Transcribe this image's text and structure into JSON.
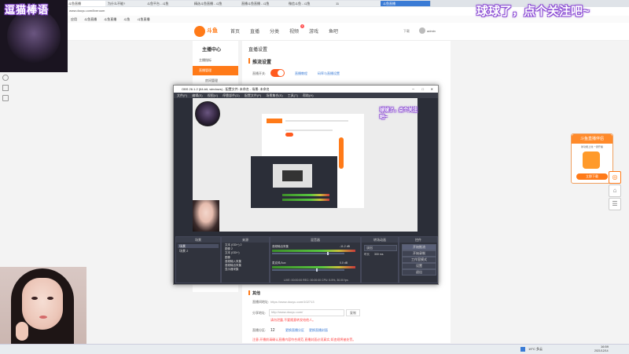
{
  "browser": {
    "tabs": [
      "斗鱼直播",
      "11",
      "为什么不能?",
      "斗鱼平台 - 斗鱼",
      "精选斗鱼直播 - 斗鱼",
      "直播斗鱼直播 - 斗鱼",
      "微信斗鱼 - 斗鱼",
      "斗鱼直播"
    ],
    "url": "www.douyu.com/liveroom",
    "bookmarks": [
      "应用",
      "斗鱼直播",
      "斗鱼直播",
      "斗鱼",
      "斗鱼直播"
    ],
    "user": "admin"
  },
  "site": {
    "logo_text": "斗鱼",
    "nav": [
      "首页",
      "直播",
      "分类",
      "视频",
      "游戏",
      "鱼吧"
    ],
    "nav_badge": "1",
    "right": [
      "下载",
      "admin"
    ]
  },
  "left_nav": {
    "title": "主播中心",
    "items": [
      "主播指标",
      "直播管理",
      "房间管理"
    ]
  },
  "main": {
    "page_title": "直播设置",
    "section_live": "推流设置",
    "toggle_label": "直播开关:",
    "link1": "直播教程",
    "link2": "码率与直播设置",
    "section_other": "其他",
    "room_label": "直播间地址:",
    "room_value": "https://www.douyu.com/102713",
    "share_label": "分享地址:",
    "share_value": "http://www.douyu.com/",
    "share_btn": "复制",
    "warn_text": "请勿泄露,不要随意转发给他人。",
    "settings_label": "直播分区:",
    "settings_value": "12",
    "settings_link1": "更换直播分区",
    "settings_link2": "更换直播封面",
    "footer1": "注意:开播前请确认直播内容符合规范,直播封面必须真实,如违规将被处罚。",
    "footer2": "点击查看直播规范"
  },
  "obs": {
    "title": "OBS 26.1.2 (64-bit, windows) - 配置文件: 未命名 - 场景: 未命名",
    "menu": [
      "文件(F)",
      "编辑(E)",
      "视图(V)",
      "停靠部件(D)",
      "配置文件(P)",
      "场景集合(S)",
      "工具(T)",
      "帮助(H)"
    ],
    "docks": [
      "场景",
      "来源",
      "混音器",
      "转场动画",
      "控件"
    ],
    "scenes": [
      "场景",
      "场景 2"
    ],
    "sources": [
      "文本 (GDI+) 2",
      "图像 2",
      "文本 (GDI+)",
      "图像",
      "音频输入采集",
      "音频输出采集",
      "显示器采集"
    ],
    "mixer": [
      {
        "name": "音频输出采集",
        "db": "-11.2 dB",
        "level": 0.78
      },
      {
        "name": "麦克风/Aux",
        "db": "0.0 dB",
        "level": 0.62
      }
    ],
    "transition": [
      "淡出",
      "时长",
      "300 ms"
    ],
    "controls": [
      "开始推流",
      "开始录制",
      "工作室模式",
      "设置",
      "退出"
    ],
    "status": "LIVE: 00:00:00   REC: 00:00:00   CPU: 5.5%, 30.00 fps"
  },
  "overlays": {
    "top_left": "逗猫棒语",
    "top_right": "球球了，点个关注吧~",
    "obs_overlay": "球球了，点个关注吧~"
  },
  "promo": {
    "title": "斗鱼直播伴侣",
    "sub": "新功能上线,一键开播",
    "btn": "立即下载"
  },
  "taskbar": {
    "time": "16:59",
    "date": "2021/12/14",
    "weather": "19°C 多云"
  }
}
